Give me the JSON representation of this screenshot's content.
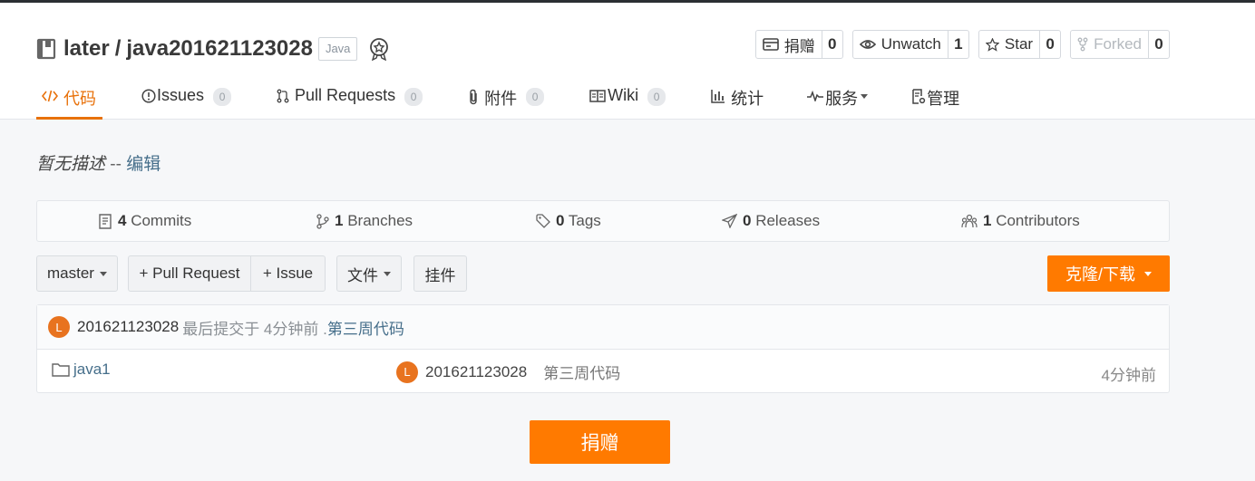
{
  "repo": {
    "owner": "later",
    "separator": "/",
    "name": "java201621123028",
    "language": "Java"
  },
  "actions": [
    {
      "label": "捐赠",
      "count": "0",
      "icon": "donate-icon"
    },
    {
      "label": "Unwatch",
      "count": "1",
      "icon": "eye-icon"
    },
    {
      "label": "Star",
      "count": "0",
      "icon": "star-icon"
    },
    {
      "label": "Forked",
      "count": "0",
      "icon": "fork-icon"
    }
  ],
  "tabs": [
    {
      "label": "代码",
      "icon": "code-icon"
    },
    {
      "label": "Issues",
      "badge": "0",
      "icon": "issue-icon"
    },
    {
      "label": "Pull Requests",
      "badge": "0",
      "icon": "pull-request-icon"
    },
    {
      "label": "附件",
      "badge": "0",
      "icon": "paperclip-icon"
    },
    {
      "label": "Wiki",
      "badge": "0",
      "icon": "book-open-icon"
    },
    {
      "label": "统计",
      "icon": "bar-chart-icon"
    },
    {
      "label": "服务",
      "icon": "pulse-icon"
    },
    {
      "label": "管理",
      "icon": "settings-doc-icon"
    }
  ],
  "description": {
    "text": "暂无描述",
    "dash": "--",
    "edit": "编辑"
  },
  "stats": [
    {
      "num": "4",
      "label": "Commits"
    },
    {
      "num": "1",
      "label": "Branches"
    },
    {
      "num": "0",
      "label": "Tags"
    },
    {
      "num": "0",
      "label": "Releases"
    },
    {
      "num": "1",
      "label": "Contributors"
    }
  ],
  "toolbar": {
    "branch": "master",
    "pull_request": "+ Pull Request",
    "issue": "+ Issue",
    "files": "文件",
    "widget": "挂件",
    "clone": "克隆/下载"
  },
  "latest_commit": {
    "avatar": "L",
    "author": "201621123028",
    "text": "最后提交于 4分钟前 .",
    "message": "第三周代码"
  },
  "files": [
    {
      "name": "java1",
      "avatar": "L",
      "author": "201621123028",
      "message": "第三周代码",
      "time": "4分钟前"
    }
  ],
  "donate_button": "捐赠",
  "colors": {
    "accent": "#ff7a00",
    "link": "#456e8a",
    "avatar": "#e8731f"
  }
}
